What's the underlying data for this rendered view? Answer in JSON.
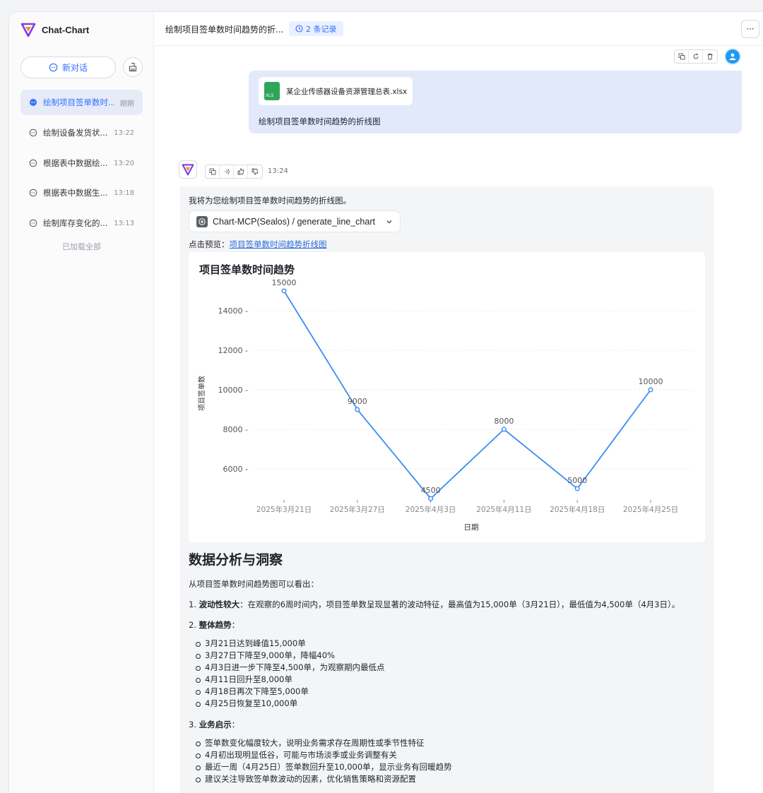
{
  "app": {
    "name": "Chat-Chart"
  },
  "sidebar": {
    "new_chat_label": "新对话",
    "items": [
      {
        "title": "绘制项目签单数时...",
        "time": "刚刚",
        "active": true
      },
      {
        "title": "绘制设备发货状...",
        "time": "13:22"
      },
      {
        "title": "根据表中数据绘...",
        "time": "13:20"
      },
      {
        "title": "根据表中数据生...",
        "time": "13:18"
      },
      {
        "title": "绘制库存变化的...",
        "time": "13:13"
      }
    ],
    "loaded_all": "已加载全部"
  },
  "header": {
    "title": "绘制项目签单数时间趋势的折...",
    "records": "2 条记录",
    "more": "···"
  },
  "user_message": {
    "file_name": "某企业传感器设备资源管理总表.xlsx",
    "file_ext": "XLS",
    "text": "绘制项目签单数时间趋势的折线图"
  },
  "assistant": {
    "time": "13:24",
    "intro": "我将为您绘制项目签单数时间趋势的折线图。",
    "tool_call": "Chart-MCP(Sealos) / generate_line_chart",
    "preview_prefix": "点击预览：",
    "preview_link": "项目签单数时间趋势折线图",
    "analysis": {
      "heading": "数据分析与洞察",
      "lead": "从项目签单数时间趋势图可以看出：",
      "p1_num": "1. ",
      "p1_bold": "波动性较大",
      "p1_text": "：在观察的6周时间内，项目签单数呈现显著的波动特征，最高值为15,000单（3月21日），最低值为4,500单（4月3日）。",
      "p2_num": "2. ",
      "p2_bold": "整体趋势",
      "p2_suffix": "：",
      "p2_items": [
        "3月21日达到峰值15,000单",
        "3月27日下降至9,000单，降幅40%",
        "4月3日进一步下降至4,500单，为观察期内最低点",
        "4月11日回升至8,000单",
        "4月18日再次下降至5,000单",
        "4月25日恢复至10,000单"
      ],
      "p3_num": "3. ",
      "p3_bold": "业务启示",
      "p3_suffix": "：",
      "p3_items": [
        "签单数变化幅度较大，说明业务需求存在周期性或季节性特征",
        "4月初出现明显低谷，可能与市场淡季或业务调整有关",
        "最近一周（4月25日）签单数回升至10,000单，显示业务有回暖趋势",
        "建议关注导致签单数波动的因素，优化销售策略和资源配置"
      ]
    }
  },
  "colors": {
    "accent": "#3370ff",
    "line": "#3b8ef0"
  },
  "chart_data": {
    "type": "line",
    "title": "项目签单数时间趋势",
    "xlabel": "日期",
    "ylabel": "项目签单数",
    "categories": [
      "2025年3月21日",
      "2025年3月27日",
      "2025年4月3日",
      "2025年4月11日",
      "2025年4月18日",
      "2025年4月25日"
    ],
    "values": [
      15000,
      9000,
      4500,
      8000,
      5000,
      10000
    ],
    "yticks": [
      6000,
      8000,
      10000,
      12000,
      14000
    ],
    "ytick_labels": [
      "6000 -",
      "8000 -",
      "10000 -",
      "12000 -",
      "14000 -"
    ],
    "ylim": [
      4500,
      15000
    ],
    "grid": true
  }
}
